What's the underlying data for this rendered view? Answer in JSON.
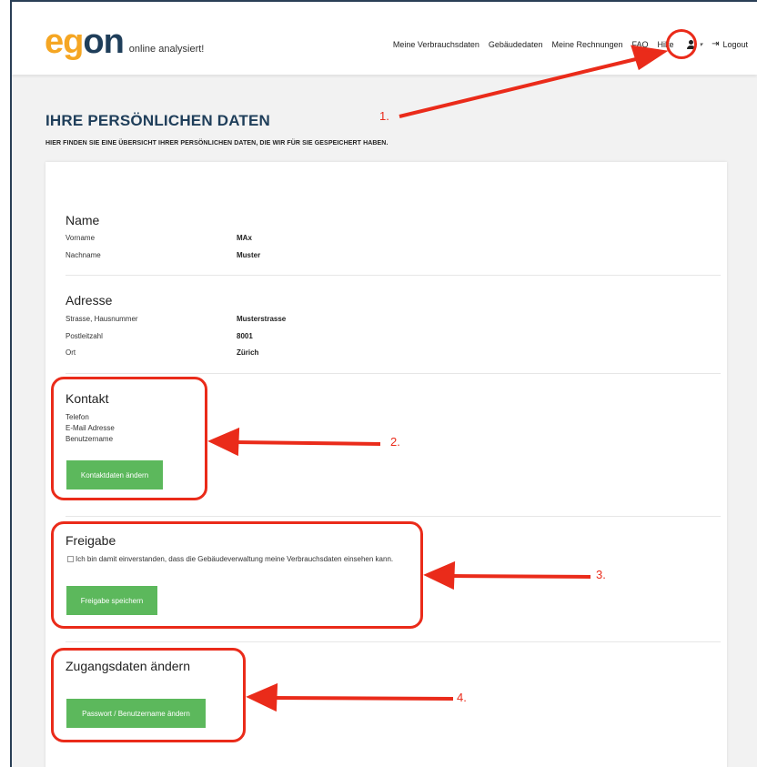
{
  "logo": {
    "part1": "e",
    "part2": "g",
    "part3": "on",
    "tagline": "online analysiert!"
  },
  "nav": {
    "items": [
      "Meine Verbrauchsdaten",
      "Gebäudedaten",
      "Meine Rechnungen",
      "FAQ",
      "Hilfe"
    ],
    "logout": "Logout"
  },
  "page": {
    "title": "IHRE PERSÖNLICHEN DATEN",
    "subtitle": "HIER FINDEN SIE EINE ÜBERSICHT IHRER PERSÖNLICHEN DATEN, DIE WIR FÜR SIE GESPEICHERT HABEN."
  },
  "name_section": {
    "title": "Name",
    "rows": [
      {
        "label": "Vorname",
        "value": "MAx"
      },
      {
        "label": "Nachname",
        "value": "Muster"
      }
    ]
  },
  "address_section": {
    "title": "Adresse",
    "rows": [
      {
        "label": "Strasse, Hausnummer",
        "value": "Musterstrasse"
      },
      {
        "label": "Postleitzahl",
        "value": "8001"
      },
      {
        "label": "Ort",
        "value": "Zürich"
      }
    ]
  },
  "contact_section": {
    "title": "Kontakt",
    "labels": [
      "Telefon",
      "E-Mail Adresse",
      "Benutzername"
    ],
    "button": "Kontaktdaten ändern"
  },
  "release_section": {
    "title": "Freigabe",
    "checkbox_label": "Ich bin damit einverstanden, dass die Gebäudeverwaltung meine Verbrauchsdaten einsehen kann.",
    "button": "Freigabe speichern"
  },
  "access_section": {
    "title": "Zugangsdaten ändern",
    "button": "Passwort / Benutzername ändern"
  },
  "annotations": [
    "1.",
    "2.",
    "3.",
    "4."
  ],
  "colors": {
    "accent_orange": "#f5a623",
    "brand_navy": "#1f3e5a",
    "button_green": "#5cb85c",
    "annotation_red": "#ea2b1a"
  }
}
